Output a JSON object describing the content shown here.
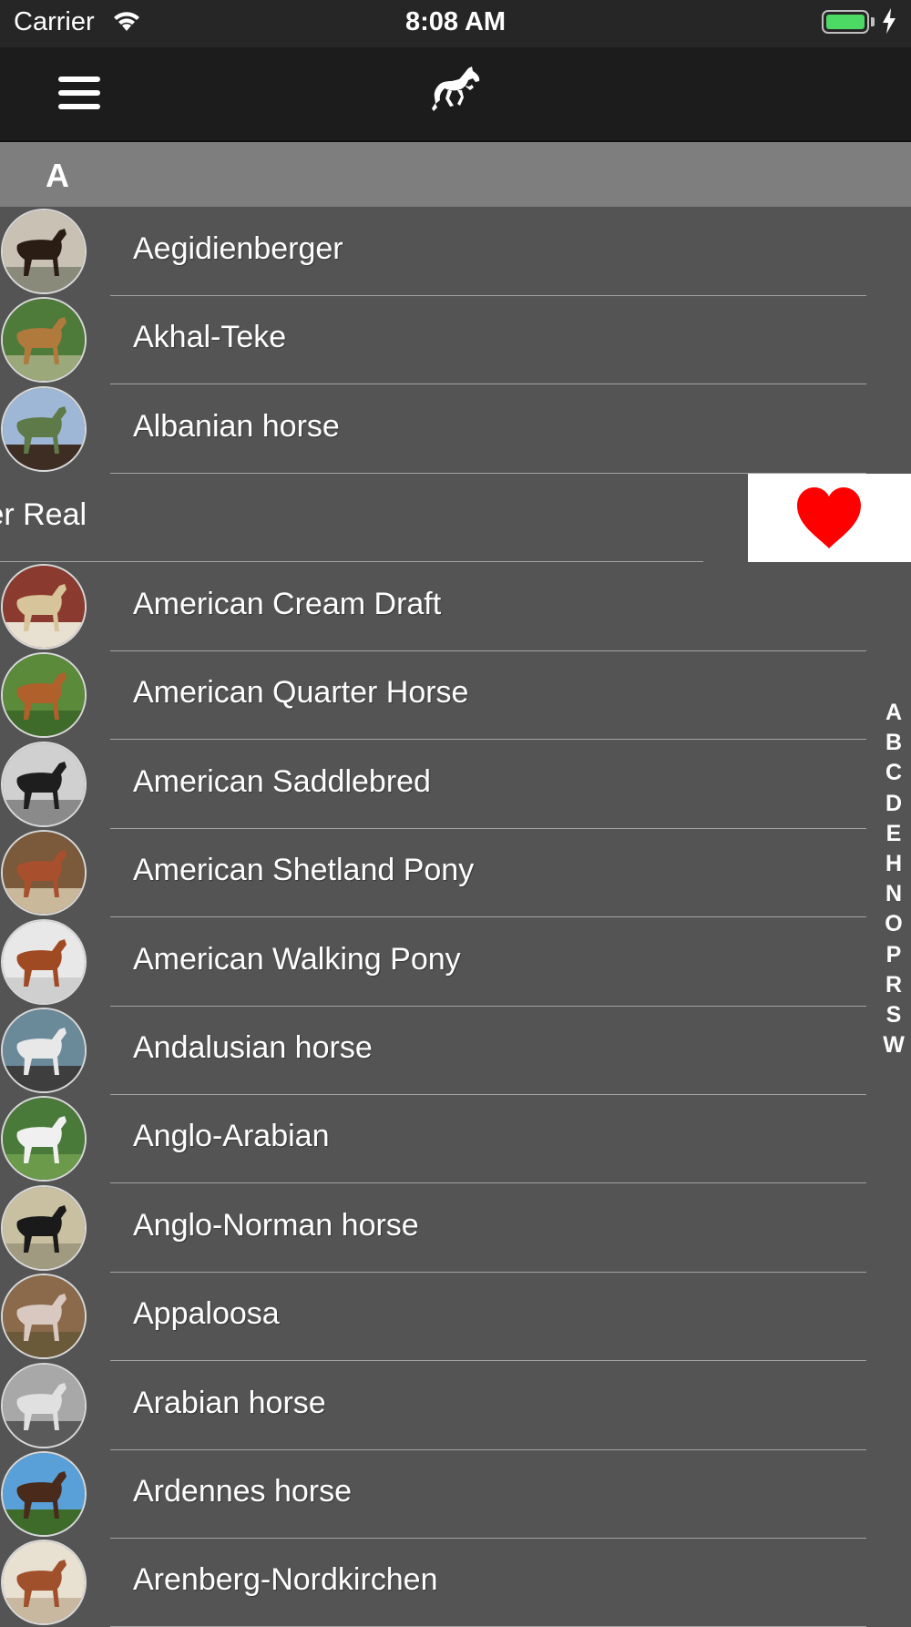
{
  "status_bar": {
    "carrier": "Carrier",
    "time": "8:08 AM",
    "battery_color": "#4cd964"
  },
  "nav_bar": {
    "menu_icon": "hamburger-menu-icon",
    "logo_icon": "galloping-horse-icon"
  },
  "section": {
    "letter": "A"
  },
  "rows": [
    {
      "label": "Aegidienberger",
      "colors": [
        "#c9c2b4",
        "#2a1d14",
        "#8a8a7a"
      ]
    },
    {
      "label": "Akhal-Teke",
      "colors": [
        "#4e7a3a",
        "#b07a3c",
        "#9aa87a"
      ]
    },
    {
      "label": "Albanian horse",
      "colors": [
        "#9fb7d6",
        "#5e7a48",
        "#3e2d22"
      ]
    }
  ],
  "swiped_row": {
    "visible_label": "ter Real",
    "action_icon": "heart-icon",
    "action_color": "#ff0000"
  },
  "rows_after": [
    {
      "label": "American Cream Draft",
      "colors": [
        "#8a3a2e",
        "#d8c49a",
        "#e8e0d0"
      ]
    },
    {
      "label": "American Quarter Horse",
      "colors": [
        "#5a8a3a",
        "#b0602a",
        "#3e6a2a"
      ]
    },
    {
      "label": "American Saddlebred",
      "colors": [
        "#d0d0d0",
        "#1e1e1e",
        "#8a8a8a"
      ]
    },
    {
      "label": "American Shetland Pony",
      "colors": [
        "#7a5a3a",
        "#a8502e",
        "#c9b89a"
      ]
    },
    {
      "label": "American Walking Pony",
      "colors": [
        "#e8e8e8",
        "#a04a24",
        "#cfcfcf"
      ]
    },
    {
      "label": "Andalusian horse",
      "colors": [
        "#6a8a9a",
        "#e8e8e8",
        "#3e3e3e"
      ]
    },
    {
      "label": "Anglo-Arabian",
      "colors": [
        "#4a7a3a",
        "#f0f0f0",
        "#6a9a4a"
      ]
    },
    {
      "label": "Anglo-Norman horse",
      "colors": [
        "#c8c0a0",
        "#1a1a1a",
        "#a09a80"
      ]
    },
    {
      "label": "Appaloosa",
      "colors": [
        "#8a6a4a",
        "#d8c8c0",
        "#6a5a3a"
      ]
    },
    {
      "label": "Arabian horse",
      "colors": [
        "#a8a8a8",
        "#e0e0e0",
        "#5a5a5a"
      ]
    },
    {
      "label": "Ardennes horse",
      "colors": [
        "#5aa0d8",
        "#4a2a1a",
        "#3e6a2a"
      ]
    },
    {
      "label": "Arenberg-Nordkirchen",
      "colors": [
        "#e8e0d0",
        "#a0502a",
        "#c8b8a0"
      ]
    }
  ],
  "index_letters": [
    "A",
    "B",
    "C",
    "D",
    "E",
    "H",
    "N",
    "O",
    "P",
    "R",
    "S",
    "W"
  ]
}
